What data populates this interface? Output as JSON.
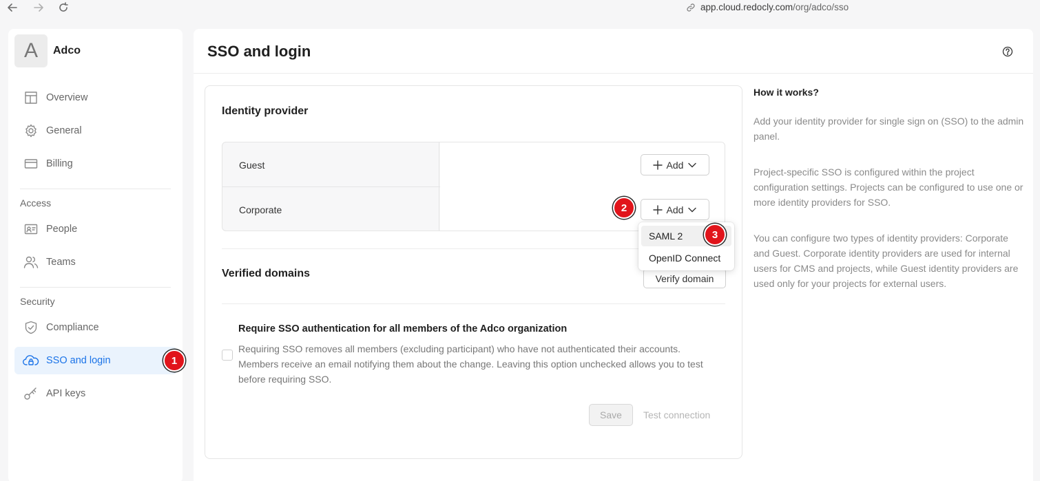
{
  "browser": {
    "url_host": "app.cloud.redocly.com",
    "url_path": "/org/adco/sso"
  },
  "sidebar": {
    "org_initial": "A",
    "org_name": "Adco",
    "items": [
      {
        "label": "Overview",
        "icon": "layout-icon"
      },
      {
        "label": "General",
        "icon": "gear-icon"
      },
      {
        "label": "Billing",
        "icon": "card-icon"
      },
      {
        "label": "People",
        "icon": "id-card-icon"
      },
      {
        "label": "Teams",
        "icon": "users-icon"
      },
      {
        "label": "Compliance",
        "icon": "shield-check-icon"
      },
      {
        "label": "SSO and login",
        "icon": "cloud-lock-icon",
        "active": true
      },
      {
        "label": "API keys",
        "icon": "key-icon"
      }
    ],
    "sections": {
      "access": "Access",
      "security": "Security"
    }
  },
  "badges": [
    "1",
    "2",
    "3"
  ],
  "main": {
    "title": "SSO and login",
    "identity_provider": {
      "heading": "Identity provider",
      "rows": [
        {
          "name": "Guest",
          "button": "Add"
        },
        {
          "name": "Corporate",
          "button": "Add"
        }
      ],
      "dropdown": [
        "SAML 2",
        "OpenID Connect"
      ]
    },
    "verified_domains": {
      "heading": "Verified domains",
      "button": "Verify domain"
    },
    "require_sso": {
      "title": "Require SSO authentication for all members of the Adco organization",
      "description": "Requiring SSO removes all members (excluding participant) who have not authenticated their accounts. Members receive an email notifying them about the change. Leaving this option unchecked allows you to test before requiring SSO."
    },
    "actions": {
      "save": "Save",
      "test": "Test connection"
    }
  },
  "aside": {
    "title": "How it works?",
    "paragraphs": [
      "Add your identity provider for single sign on (SSO) to the admin panel.",
      "Project-specific SSO is configured within the project configuration settings. Projects can be configured to use one or more identity providers for SSO.",
      "You can configure two types of identity providers: Corporate and Guest. Corporate identity providers are used for internal users for CMS and projects, while Guest identity providers are used only for your projects for external users."
    ]
  },
  "colors": {
    "accent": "#1a73e8",
    "active_bg": "#eaf3fd",
    "badge": "#e1141b"
  }
}
